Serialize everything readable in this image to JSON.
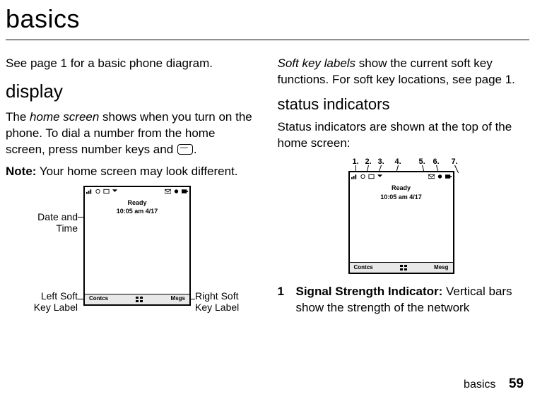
{
  "page": {
    "title": "basics",
    "footer_label": "basics",
    "page_number": "59"
  },
  "left": {
    "intro": "See page 1 for a basic phone diagram.",
    "section": "display",
    "para1_pre": "The ",
    "para1_em": "home screen",
    "para1_post": " shows when you turn on the phone. To dial a number from the home screen, press number keys and ",
    "para1_end": ".",
    "note_label": "Note:",
    "note_body": " Your home screen may look different.",
    "callout_datetime_l1": "Date and",
    "callout_datetime_l2": "Time",
    "callout_leftsoft_l1": "Left Soft",
    "callout_leftsoft_l2": "Key Label",
    "callout_rightsoft_l1": "Right Soft",
    "callout_rightsoft_l2": "Key Label",
    "phone": {
      "ready": "Ready",
      "datetime": "10:05 am  4/17",
      "left_soft": "Contcs",
      "right_soft": "Msgs"
    }
  },
  "right": {
    "para1_em": "Soft key labels",
    "para1_body": " show the current soft key functions. For soft key locations, see page 1.",
    "subsection": "status indicators",
    "para2": "Status indicators are shown at the top of the home screen:",
    "numbers": [
      "1.",
      "2.",
      "3.",
      "4.",
      "5.",
      "6.",
      "7."
    ],
    "phone": {
      "ready": "Ready",
      "datetime": "10:05 am  4/17",
      "left_soft": "Contcs",
      "right_soft": "Mesg"
    },
    "list": {
      "num": "1",
      "label": "Signal Strength Indicator:",
      "body": " Vertical bars show the strength of the network"
    }
  }
}
